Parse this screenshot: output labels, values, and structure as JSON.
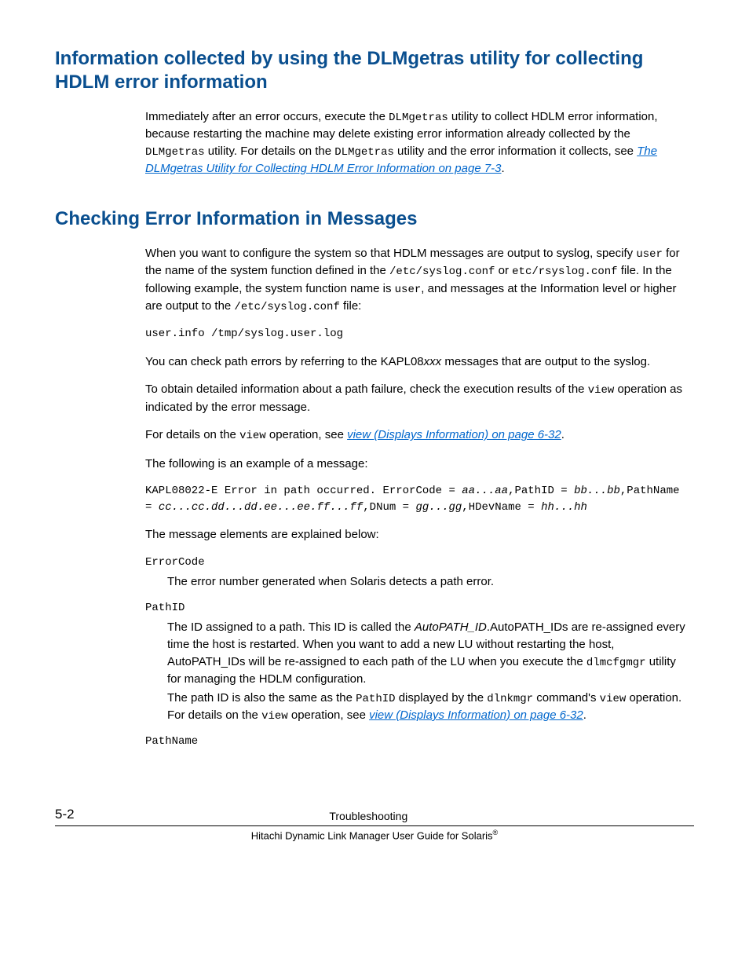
{
  "section1": {
    "heading": "Information collected by using the DLMgetras utility for collecting HDLM error information",
    "p1_a": "Immediately after an error occurs, execute the ",
    "p1_mono1": "DLMgetras",
    "p1_b": " utility to collect HDLM error information, because restarting the machine may delete existing error information already collected by the ",
    "p1_mono2": "DLMgetras",
    "p1_c": " utility. For details on the ",
    "p1_mono3": "DLMgetras",
    "p1_d": " utility and the error information it collects, see ",
    "p1_link": "The DLMgetras Utility for Collecting HDLM Error Information on page 7-3",
    "p1_e": "."
  },
  "section2": {
    "heading": "Checking Error Information in Messages",
    "p1_a": "When you want to configure the system so that HDLM messages are output to syslog, specify ",
    "p1_mono1": "user",
    "p1_b": " for the name of the system function defined in the ",
    "p1_mono2": "/etc/syslog.conf",
    "p1_c": " or ",
    "p1_mono3": "etc/rsyslog.conf",
    "p1_d": " file. In the following example, the system function name is ",
    "p1_mono4": "user",
    "p1_e": ", and messages at the Information level or higher are output to the ",
    "p1_mono5": "/etc/syslog.conf",
    "p1_f": " file:",
    "code1": "user.info /tmp/syslog.user.log",
    "p2_a": "You can check path errors by referring to the KAPL08",
    "p2_ital": "xxx",
    "p2_b": " messages that are output to the syslog.",
    "p3_a": "To obtain detailed information about a path failure, check the execution results of the ",
    "p3_mono1": "view",
    "p3_b": " operation as indicated by the error message.",
    "p4_a": "For details on the ",
    "p4_mono1": "view",
    "p4_b": " operation, see ",
    "p4_link": "view (Displays Information) on page 6-32",
    "p4_c": ".",
    "p5": "The following is an example of a message:",
    "code2_a": "KAPL08022-E Error in path occurred. ErrorCode = ",
    "code2_i1": "aa...aa",
    "code2_b": ",PathID = ",
    "code2_i2": "bb...bb",
    "code2_c": ",PathName = ",
    "code2_i3": "cc...cc.dd...dd.ee...ee.ff...ff",
    "code2_d": ",DNum = ",
    "code2_i4": "gg...gg",
    "code2_e": ",HDevName = ",
    "code2_i5": "hh...hh",
    "p6": "The message elements are explained below:",
    "dl": {
      "t1": "ErrorCode",
      "d1": "The error number generated when Solaris detects a path error.",
      "t2": "PathID",
      "d2p1_a": "The ID assigned to a path. This ID is called the ",
      "d2p1_ital": "AutoPATH_ID",
      "d2p1_b": ".AutoPATH_IDs are re-assigned every time the host is restarted. When you want to add a new LU without restarting the host, AutoPATH_IDs will be re-assigned to each path of the LU when you execute the ",
      "d2p1_mono": "dlmcfgmgr",
      "d2p1_c": " utility for managing the HDLM configuration.",
      "d2p2_a": "The path ID is also the same as the ",
      "d2p2_mono1": "PathID",
      "d2p2_b": " displayed by the ",
      "d2p2_mono2": "dlnkmgr",
      "d2p2_c": " command's ",
      "d2p2_mono3": "view",
      "d2p2_d": " operation. For details on the ",
      "d2p2_mono4": "view",
      "d2p2_e": " operation, see ",
      "d2p2_link": "view (Displays Information) on page 6-32",
      "d2p2_f": ".",
      "t3": "PathName"
    }
  },
  "footer": {
    "page": "5-2",
    "center": "Troubleshooting",
    "guide_a": "Hitachi Dynamic Link Manager User Guide for Solaris",
    "guide_sup": "®"
  }
}
